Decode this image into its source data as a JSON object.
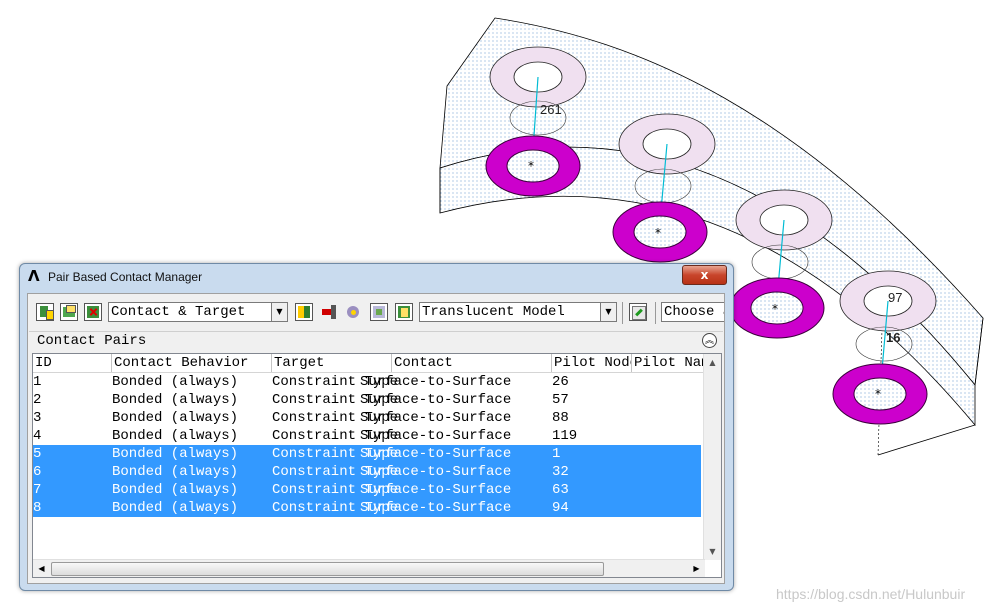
{
  "window": {
    "title": "Pair Based Contact Manager",
    "close_glyph": "x",
    "logo_glyph": "Λ"
  },
  "toolbar": {
    "icons_left": [
      "list-new-icon",
      "list-open-icon",
      "delete-pair-icon"
    ],
    "view_select": {
      "value": "Contact & Target"
    },
    "icons_middle": [
      "plot-pair-icon",
      "flip-icon",
      "check-icon",
      "edit-icon",
      "properties-icon"
    ],
    "model_select": {
      "value": "Translucent Model"
    },
    "icons_right": [
      "checklist-icon"
    ],
    "choose_select": {
      "value": "Choose a"
    }
  },
  "section": {
    "title": "Contact Pairs",
    "collapse_glyph": "^^"
  },
  "table": {
    "columns": [
      "ID",
      "Contact Behavior",
      "Target",
      "Contact",
      "Pilot Node",
      "Pilot Name"
    ],
    "rows": [
      {
        "id": "1",
        "behavior": "Bonded (always)",
        "target": "Constraint Type",
        "contact": "Surface-to-Surface",
        "pilot_node": "26",
        "selected": false
      },
      {
        "id": "2",
        "behavior": "Bonded (always)",
        "target": "Constraint Type",
        "contact": "Surface-to-Surface",
        "pilot_node": "57",
        "selected": false
      },
      {
        "id": "3",
        "behavior": "Bonded (always)",
        "target": "Constraint Type",
        "contact": "Surface-to-Surface",
        "pilot_node": "88",
        "selected": false
      },
      {
        "id": "4",
        "behavior": "Bonded (always)",
        "target": "Constraint Type",
        "contact": "Surface-to-Surface",
        "pilot_node": "119",
        "selected": false
      },
      {
        "id": "5",
        "behavior": "Bonded (always)",
        "target": "Constraint Type",
        "contact": "Surface-to-Surface",
        "pilot_node": "1",
        "selected": true
      },
      {
        "id": "6",
        "behavior": "Bonded (always)",
        "target": "Constraint Type",
        "contact": "Surface-to-Surface",
        "pilot_node": "32",
        "selected": true
      },
      {
        "id": "7",
        "behavior": "Bonded (always)",
        "target": "Constraint Type",
        "contact": "Surface-to-Surface",
        "pilot_node": "63",
        "selected": true
      },
      {
        "id": "8",
        "behavior": "Bonded (always)",
        "target": "Constraint Type",
        "contact": "Surface-to-Surface",
        "pilot_node": "94",
        "selected": true
      }
    ],
    "selection_color": "#3399ff"
  },
  "viewport": {
    "labels": [
      "261",
      "97",
      "16"
    ],
    "washer_color": "#cc00cc",
    "pilot_line_color": "#00bcd4"
  },
  "watermark": "https://blog.csdn.net/Hulunbuir"
}
